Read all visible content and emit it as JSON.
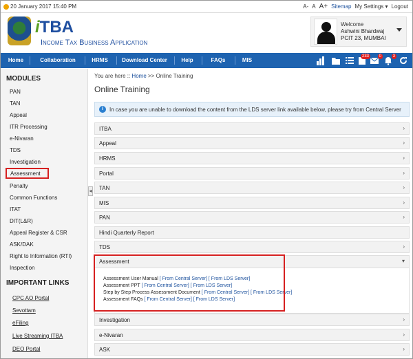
{
  "topbar": {
    "datetime": "20 January 2017 15:40 PM",
    "font_small": "A-",
    "font_normal": "A",
    "font_large": "A+",
    "sitemap": "Sitemap",
    "settings": "My Settings",
    "logout": "Logout"
  },
  "brand": {
    "logo_i": "i",
    "logo_itba": "TBA",
    "subtitle": "Income Tax Business Application"
  },
  "user": {
    "welcome": "Welcome",
    "name": "Ashwini Bhardwaj",
    "org": "PCIT 23, MUMBAI"
  },
  "nav": {
    "items": [
      "Home",
      "Collaboration",
      "HRMS",
      "Download Center",
      "Help",
      "FAQs",
      "MIS"
    ],
    "badges": [
      "233",
      "0",
      "3"
    ]
  },
  "sidebar": {
    "modules_title": "MODULES",
    "modules": [
      "PAN",
      "TAN",
      "Appeal",
      "ITR Processing",
      "e-Nivaran",
      "TDS",
      "Investigation",
      "Assessment",
      "Penalty",
      "Common Functions",
      "ITAT",
      "DIT(L&R)",
      "Appeal Register & CSR",
      "ASK/DAK",
      "Right to Information (RTI)",
      "Inspection"
    ],
    "links_title": "IMPORTANT LINKS",
    "links": [
      "CPC AO Portal",
      "Sevottam",
      "eFiling",
      "Live Streaming ITBA",
      "DEO Portal"
    ]
  },
  "main": {
    "breadcrumb_prefix": "You are here ::",
    "breadcrumb_home": "Home",
    "breadcrumb_sep": ">>",
    "breadcrumb_current": "Online Training",
    "title": "Online Training",
    "info": "In case you are unable to download the content from the LDS server link available below, please try from Central Server",
    "sections_before": [
      "ITBA",
      "Appeal",
      "HRMS",
      "Portal",
      "TAN",
      "MIS",
      "PAN",
      "Hindi Quarterly Report",
      "TDS"
    ],
    "open_section": "Assessment",
    "open_items": [
      {
        "label": "Assessment User Manual",
        "central": "[ From Central Server]",
        "lds": "[ From LDS Server]"
      },
      {
        "label": "Assessment PPT",
        "central": "[ From Central Server]",
        "lds": "[ From LDS Server]"
      },
      {
        "label": "Step by Step Process Assessment Document",
        "central": "[ From Central Server]",
        "lds": "[ From LDS Server]"
      },
      {
        "label": "Assessment FAQs",
        "central": "[ From Central Server]",
        "lds": "[ From LDS Server]"
      }
    ],
    "sections_after": [
      "Investigation",
      "e-Nivaran",
      "ASK"
    ]
  }
}
